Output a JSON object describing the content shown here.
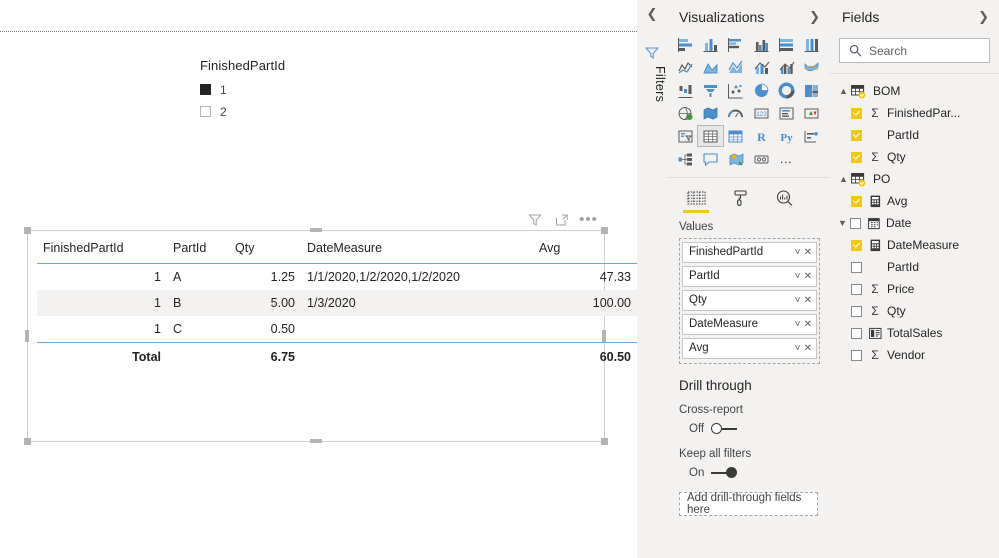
{
  "canvas": {
    "slicer": {
      "title": "FinishedPartId",
      "items": [
        {
          "label": "1",
          "checked": true
        },
        {
          "label": "2",
          "checked": false
        }
      ]
    },
    "table_visual": {
      "header_icons": [
        "filter-icon",
        "focus-mode-icon",
        "more-options-icon"
      ],
      "columns": [
        "FinishedPartId",
        "PartId",
        "Qty",
        "DateMeasure",
        "Avg"
      ],
      "rows": [
        {
          "FinishedPartId": "1",
          "PartId": "A",
          "Qty": "1.25",
          "DateMeasure": "1/1/2020,1/2/2020,1/2/2020",
          "Avg": "47.33"
        },
        {
          "FinishedPartId": "1",
          "PartId": "B",
          "Qty": "5.00",
          "DateMeasure": "1/3/2020",
          "Avg": "100.00"
        },
        {
          "FinishedPartId": "1",
          "PartId": "C",
          "Qty": "0.50",
          "DateMeasure": "",
          "Avg": ""
        }
      ],
      "total": {
        "label": "Total",
        "Qty": "6.75",
        "DateMeasure": "",
        "Avg": "60.50"
      }
    }
  },
  "filters_rail": {
    "collapse_icon": "chevron-left-icon",
    "funnel_icon": "filter-funnel-icon",
    "label": "Filters"
  },
  "visualizations": {
    "title": "Visualizations",
    "expand_icon": "chevron-right-icon",
    "gallery": [
      {
        "name": "stacked-bar-chart",
        "selected": false
      },
      {
        "name": "stacked-column-chart",
        "selected": false
      },
      {
        "name": "clustered-bar-chart",
        "selected": false
      },
      {
        "name": "clustered-column-chart",
        "selected": false
      },
      {
        "name": "100-percent-stacked-bar-chart",
        "selected": false
      },
      {
        "name": "100-percent-stacked-column-chart",
        "selected": false
      },
      {
        "name": "line-chart",
        "selected": false
      },
      {
        "name": "area-chart",
        "selected": false
      },
      {
        "name": "stacked-area-chart",
        "selected": false
      },
      {
        "name": "line-and-stacked-column-chart",
        "selected": false
      },
      {
        "name": "line-and-clustered-column-chart",
        "selected": false
      },
      {
        "name": "ribbon-chart",
        "selected": false
      },
      {
        "name": "waterfall-chart",
        "selected": false
      },
      {
        "name": "funnel-chart",
        "selected": false
      },
      {
        "name": "scatter-chart",
        "selected": false
      },
      {
        "name": "pie-chart",
        "selected": false
      },
      {
        "name": "donut-chart",
        "selected": false
      },
      {
        "name": "treemap-chart",
        "selected": false
      },
      {
        "name": "map-visual",
        "selected": false
      },
      {
        "name": "filled-map-visual",
        "selected": false
      },
      {
        "name": "gauge-visual",
        "selected": false
      },
      {
        "name": "card-visual",
        "selected": false
      },
      {
        "name": "multi-row-card-visual",
        "selected": false
      },
      {
        "name": "kpi-visual",
        "selected": false
      },
      {
        "name": "slicer-visual",
        "selected": false
      },
      {
        "name": "table-visual",
        "selected": true
      },
      {
        "name": "matrix-visual",
        "selected": false
      },
      {
        "name": "r-script-visual",
        "selected": false
      },
      {
        "name": "python-script-visual",
        "selected": false
      },
      {
        "name": "decomposition-tree-visual",
        "selected": false
      },
      {
        "name": "key-influencers-visual",
        "selected": false
      },
      {
        "name": "qna-visual",
        "selected": false
      },
      {
        "name": "arcgis-map-visual",
        "selected": false
      },
      {
        "name": "paginated-report-visual",
        "selected": false
      },
      {
        "name": "more-visuals",
        "selected": false
      }
    ],
    "gallery_more_label": "…",
    "tabs": [
      {
        "name": "fields-tab",
        "icon": "fields-grid-icon",
        "active": true
      },
      {
        "name": "format-tab",
        "icon": "paint-roller-icon",
        "active": false
      },
      {
        "name": "analytics-tab",
        "icon": "magnifier-chart-icon",
        "active": false
      }
    ],
    "wells": {
      "label": "Values",
      "chips": [
        {
          "name": "FinishedPartId"
        },
        {
          "name": "PartId"
        },
        {
          "name": "Qty"
        },
        {
          "name": "DateMeasure"
        },
        {
          "name": "Avg"
        }
      ]
    },
    "drill_through": {
      "title": "Drill through",
      "cross_report": {
        "label": "Cross-report",
        "state": "Off",
        "on": false
      },
      "keep_all_filters": {
        "label": "Keep all filters",
        "state": "On",
        "on": true
      },
      "drop_zone": "Add drill-through fields here"
    }
  },
  "fields": {
    "title": "Fields",
    "expand_icon": "chevron-right-icon",
    "search": {
      "placeholder": "Search",
      "value": "",
      "icon": "search-icon"
    },
    "tables": [
      {
        "name": "BOM",
        "expanded": true,
        "chevron": "chevron-up-icon",
        "icon": "table-checked-icon",
        "items": [
          {
            "label": "FinishedPar...",
            "checked": true,
            "marker": "sigma",
            "icon": ""
          },
          {
            "label": "PartId",
            "checked": true,
            "marker": "none",
            "icon": ""
          },
          {
            "label": "Qty",
            "checked": true,
            "marker": "sigma",
            "icon": ""
          }
        ]
      },
      {
        "name": "PO",
        "expanded": true,
        "chevron": "chevron-up-icon",
        "icon": "table-checked-icon",
        "items": [
          {
            "label": "Avg",
            "checked": true,
            "marker": "icon",
            "icon": "measure-icon"
          },
          {
            "label": "Date",
            "checked": false,
            "marker": "icon",
            "icon": "calendar-icon",
            "chevron": "chevron-down-icon"
          },
          {
            "label": "DateMeasure",
            "checked": true,
            "marker": "icon",
            "icon": "measure-icon"
          },
          {
            "label": "PartId",
            "checked": false,
            "marker": "none",
            "icon": ""
          },
          {
            "label": "Price",
            "checked": false,
            "marker": "sigma",
            "icon": ""
          },
          {
            "label": "Qty",
            "checked": false,
            "marker": "sigma",
            "icon": ""
          },
          {
            "label": "TotalSales",
            "checked": false,
            "marker": "icon",
            "icon": "calculated-column-icon"
          },
          {
            "label": "Vendor",
            "checked": false,
            "marker": "sigma",
            "icon": ""
          }
        ]
      }
    ]
  },
  "colors": {
    "accent_yellow": "#f2c811",
    "table_rule_blue": "#66a9e0",
    "panel_bg": "#f3f2f1",
    "icon_blue": "#4a90cf",
    "icon_gray": "#5b5b5b"
  }
}
